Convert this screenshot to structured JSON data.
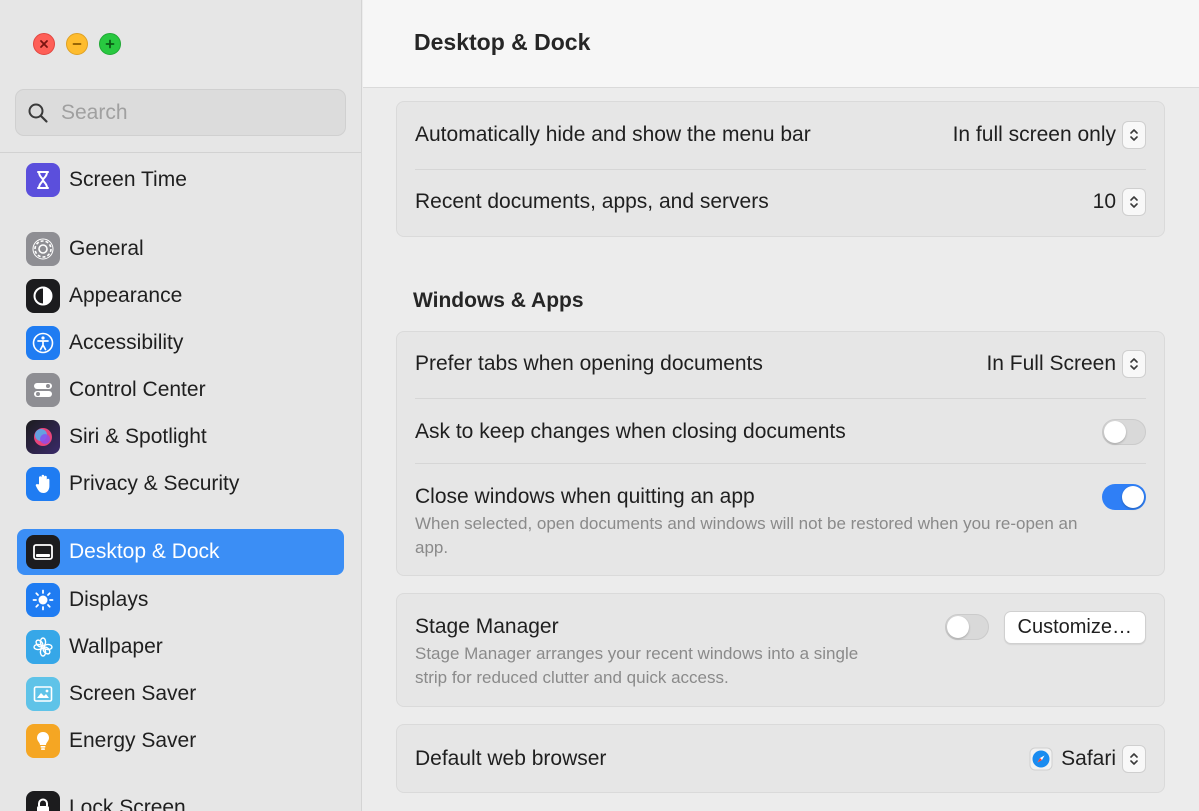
{
  "window": {
    "title": "Desktop & Dock"
  },
  "search": {
    "placeholder": "Search"
  },
  "sidebar": {
    "items": [
      {
        "label": "Screen Time",
        "icon": "hourglass-icon",
        "color": "#5b4fdc"
      },
      {
        "label": "General",
        "icon": "gear-icon",
        "color": "#8e8e93"
      },
      {
        "label": "Appearance",
        "icon": "appearance-icon",
        "color": "#1c1c1e"
      },
      {
        "label": "Accessibility",
        "icon": "accessibility-icon",
        "color": "#1f7cf2"
      },
      {
        "label": "Control Center",
        "icon": "control-center-icon",
        "color": "#8e8e93"
      },
      {
        "label": "Siri & Spotlight",
        "icon": "siri-icon",
        "color": "#7a3fd8"
      },
      {
        "label": "Privacy & Security",
        "icon": "hand-icon",
        "color": "#1f7cf2"
      },
      {
        "label": "Desktop & Dock",
        "icon": "dock-icon",
        "color": "#1c1c1e",
        "active": true
      },
      {
        "label": "Displays",
        "icon": "sun-icon",
        "color": "#1f7cf2"
      },
      {
        "label": "Wallpaper",
        "icon": "flower-icon",
        "color": "#36a7e8"
      },
      {
        "label": "Screen Saver",
        "icon": "screen-saver-icon",
        "color": "#5fc3e8"
      },
      {
        "label": "Energy Saver",
        "icon": "lightbulb-icon",
        "color": "#f5a623"
      },
      {
        "label": "Lock Screen",
        "icon": "lock-icon",
        "color": "#1c1c1e"
      }
    ]
  },
  "settings": {
    "menu_bar": {
      "label": "Automatically hide and show the menu bar",
      "value": "In full screen only"
    },
    "recent_items": {
      "label": "Recent documents, apps, and servers",
      "value": "10"
    },
    "windows_section_title": "Windows & Apps",
    "prefer_tabs": {
      "label": "Prefer tabs when opening documents",
      "value": "In Full Screen"
    },
    "ask_keep_changes": {
      "label": "Ask to keep changes when closing documents",
      "enabled": false
    },
    "close_windows": {
      "label": "Close windows when quitting an app",
      "description": "When selected, open documents and windows will not be restored when you re-open an app.",
      "enabled": true
    },
    "stage_manager": {
      "label": "Stage Manager",
      "description": "Stage Manager arranges your recent windows into a single strip for reduced clutter and quick access.",
      "enabled": false,
      "customize_label": "Customize…"
    },
    "default_browser": {
      "label": "Default web browser",
      "value": "Safari"
    }
  },
  "colors": {
    "accent": "#3b8ef5",
    "toggle_on": "#2f7ff6"
  }
}
